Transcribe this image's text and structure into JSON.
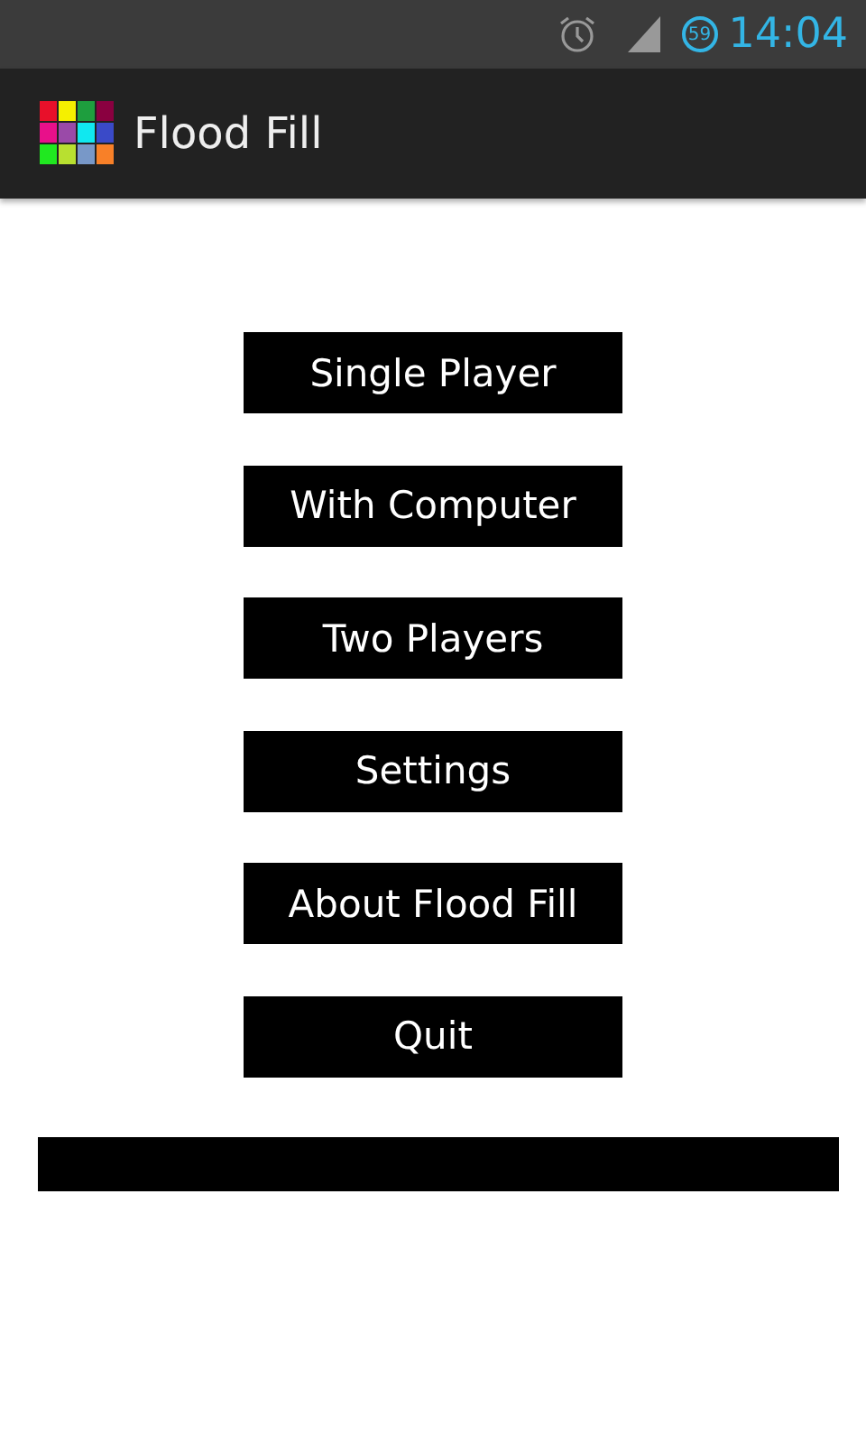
{
  "status_bar": {
    "battery": "59",
    "time": "14:04"
  },
  "action_bar": {
    "title": "Flood Fill"
  },
  "menu": [
    {
      "label": "Single Player"
    },
    {
      "label": "With Computer"
    },
    {
      "label": "Two Players"
    },
    {
      "label": "Settings"
    },
    {
      "label": "About Flood Fill"
    },
    {
      "label": "Quit"
    }
  ]
}
